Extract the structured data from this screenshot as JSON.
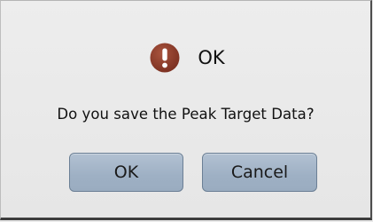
{
  "dialog": {
    "title": "OK",
    "icon": "exclamation-icon",
    "message": "Do you save the Peak Target Data?",
    "ok_label": "OK",
    "cancel_label": "Cancel",
    "colors": {
      "icon_fill": "#8a3b2a",
      "button_fill": "#a7b8ca",
      "background": "#e9e9e9"
    }
  }
}
